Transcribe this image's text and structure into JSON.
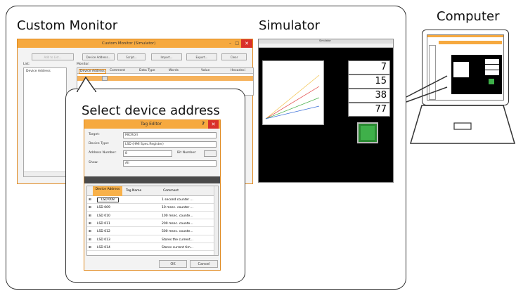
{
  "labels": {
    "custom_monitor": "Custom Monitor",
    "simulator": "Simulator",
    "computer": "Computer",
    "select_device_address": "Select device address"
  },
  "custom_monitor_window": {
    "title": "Custom Monitor (Simulator)",
    "buttons": {
      "add_list": "Add to List...",
      "device_address": "Device Address...",
      "script": "Script...",
      "import": "Import...",
      "export": "Export...",
      "clear": "Clear"
    },
    "list_label": "List:",
    "list_header": "Device Address",
    "monitor_label": "Monitor:",
    "columns": [
      "Device Address",
      "Comment",
      "Data Type",
      "Words",
      "Value",
      "Hexadeci"
    ]
  },
  "simulator_window": {
    "title": "Simulator",
    "values": [
      "7",
      "15",
      "38",
      "77"
    ],
    "accent_color": "#3fb04a"
  },
  "tag_editor": {
    "title": "Tag Editor",
    "help": "?",
    "target_label": "Target:",
    "target_value": "MICRO/I",
    "device_type_label": "Device Type:",
    "device_type_value": "LSD (HMI Spec.Register)",
    "address_number_label": "Address Number:",
    "address_number_value": "8",
    "bit_number_label": "Bit Number:",
    "show_label": "Show:",
    "show_value": "All",
    "columns": [
      "Device Address",
      "Tag Name",
      "Comment"
    ],
    "rows": [
      {
        "address": "LSD 008",
        "comment": "1 second counter ..."
      },
      {
        "address": "LSD 009",
        "comment": "10 msec. counter ..."
      },
      {
        "address": "LSD 010",
        "comment": "100 msec. counte..."
      },
      {
        "address": "LSD 011",
        "comment": "200 msec. counte..."
      },
      {
        "address": "LSD 012",
        "comment": "500 msec. counte..."
      },
      {
        "address": "LSD 013",
        "comment": "Stores the current..."
      },
      {
        "address": "LSD 014",
        "comment": "Stores current tim..."
      }
    ],
    "ok": "OK",
    "cancel": "Cancel"
  }
}
